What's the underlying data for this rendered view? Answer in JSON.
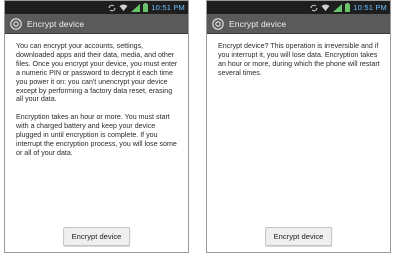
{
  "colors": {
    "status_bar": "#1e1e1e",
    "title_bar": "#5a5a5a",
    "clock": "#6fc3ff",
    "signal": "#66c56a"
  },
  "status_bar": {
    "time": "10:51 PM",
    "icons": [
      "sync-icon",
      "wifi-icon",
      "signal-icon",
      "battery-icon"
    ]
  },
  "left": {
    "title": "Encrypt device",
    "paragraph1": "You can encrypt your accounts, settings, downloaded apps and their data, media, and other files. Once you encrypt your device, you must enter a numeric PIN or password to decrypt it each time you power it on: you can't unencrypt your device except by performing a factory data reset, erasing all your data.",
    "paragraph2": "Encryption takes an hour or more. You must start with a charged battery and keep your device plugged in until encryption is complete. If you interrupt the encryption process, you will lose some or all of your data.",
    "button": "Encrypt device"
  },
  "right": {
    "title": "Encrypt device",
    "paragraph1": "Encrypt device? This operation is irreversible and if you interrupt it, you will lose data. Encryption takes an hour or more, during which the phone will restart several times.",
    "button": "Encrypt device"
  }
}
